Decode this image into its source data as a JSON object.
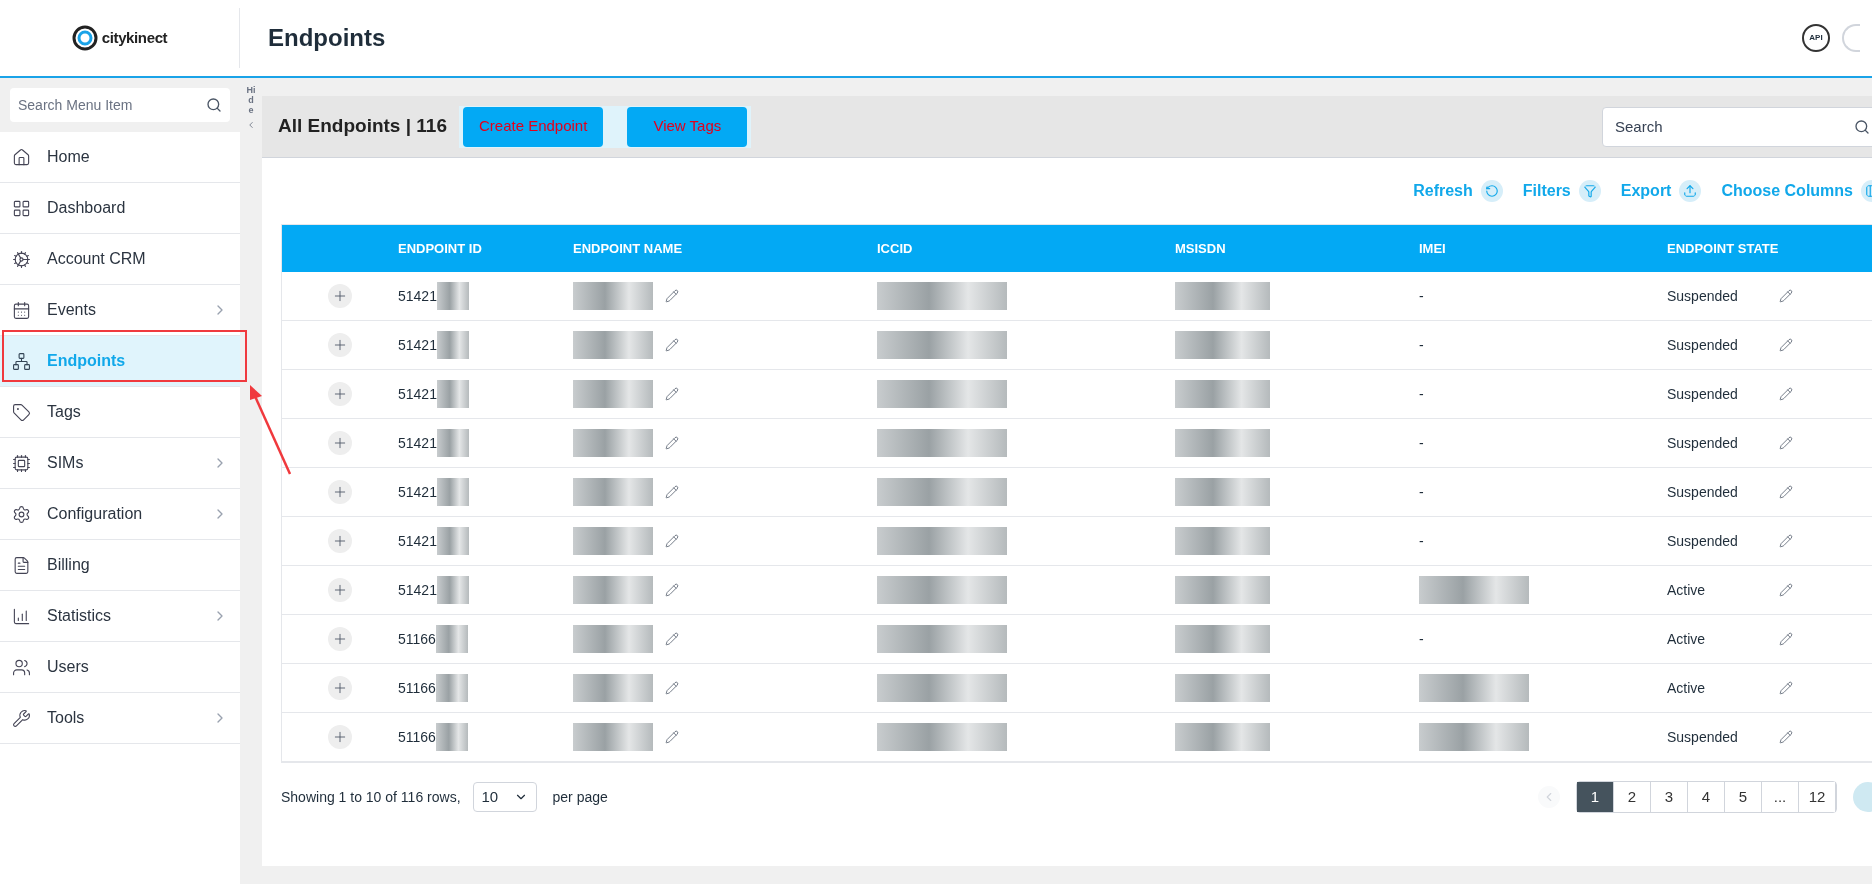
{
  "header": {
    "logo_text": "citykinect",
    "title": "Endpoints",
    "api_label": "API"
  },
  "sidebar": {
    "search_placeholder": "Search Menu Item",
    "hide_label": "Hide",
    "items": [
      {
        "label": "Home",
        "selected": false,
        "has_submenu": false
      },
      {
        "label": "Dashboard",
        "selected": false,
        "has_submenu": false
      },
      {
        "label": "Account CRM",
        "selected": false,
        "has_submenu": false
      },
      {
        "label": "Events",
        "selected": false,
        "has_submenu": true
      },
      {
        "label": "Endpoints",
        "selected": true,
        "has_submenu": false
      },
      {
        "label": "Tags",
        "selected": false,
        "has_submenu": false
      },
      {
        "label": "SIMs",
        "selected": false,
        "has_submenu": true
      },
      {
        "label": "Configuration",
        "selected": false,
        "has_submenu": true
      },
      {
        "label": "Billing",
        "selected": false,
        "has_submenu": false
      },
      {
        "label": "Statistics",
        "selected": false,
        "has_submenu": true
      },
      {
        "label": "Users",
        "selected": false,
        "has_submenu": false
      },
      {
        "label": "Tools",
        "selected": false,
        "has_submenu": true
      }
    ]
  },
  "card": {
    "title": "All Endpoints | 116",
    "buttons": [
      "Create Endpoint",
      "View Tags"
    ],
    "search_placeholder": "Search",
    "actions": [
      "Refresh",
      "Filters",
      "Export",
      "Choose Columns"
    ]
  },
  "table": {
    "columns": [
      "ENDPOINT ID",
      "ENDPOINT NAME",
      "ICCID",
      "MSISDN",
      "IMEI",
      "ENDPOINT STATE"
    ],
    "rows": [
      {
        "endpoint_id": "51421",
        "imei": "-",
        "state": "Suspended"
      },
      {
        "endpoint_id": "51421",
        "imei": "-",
        "state": "Suspended"
      },
      {
        "endpoint_id": "51421",
        "imei": "-",
        "state": "Suspended"
      },
      {
        "endpoint_id": "51421",
        "imei": "-",
        "state": "Suspended"
      },
      {
        "endpoint_id": "51421",
        "imei": "-",
        "state": "Suspended"
      },
      {
        "endpoint_id": "51421",
        "imei": "-",
        "state": "Suspended"
      },
      {
        "endpoint_id": "51421",
        "imei_redacted": true,
        "state": "Active"
      },
      {
        "endpoint_id": "51166",
        "imei": "-",
        "state": "Active"
      },
      {
        "endpoint_id": "51166",
        "imei_redacted": true,
        "state": "Active"
      },
      {
        "endpoint_id": "51166",
        "imei_redacted": true,
        "state": "Suspended"
      }
    ]
  },
  "footer": {
    "summary": "Showing 1 to 10 of 116 rows,",
    "per_page": "10",
    "per_page_label": "per page",
    "pages": [
      {
        "label": "1",
        "selected": true
      },
      {
        "label": "2",
        "selected": false
      },
      {
        "label": "3",
        "selected": false
      },
      {
        "label": "4",
        "selected": false
      },
      {
        "label": "5",
        "selected": false
      },
      {
        "label": "...",
        "selected": false
      },
      {
        "label": "12",
        "selected": false
      }
    ]
  }
}
